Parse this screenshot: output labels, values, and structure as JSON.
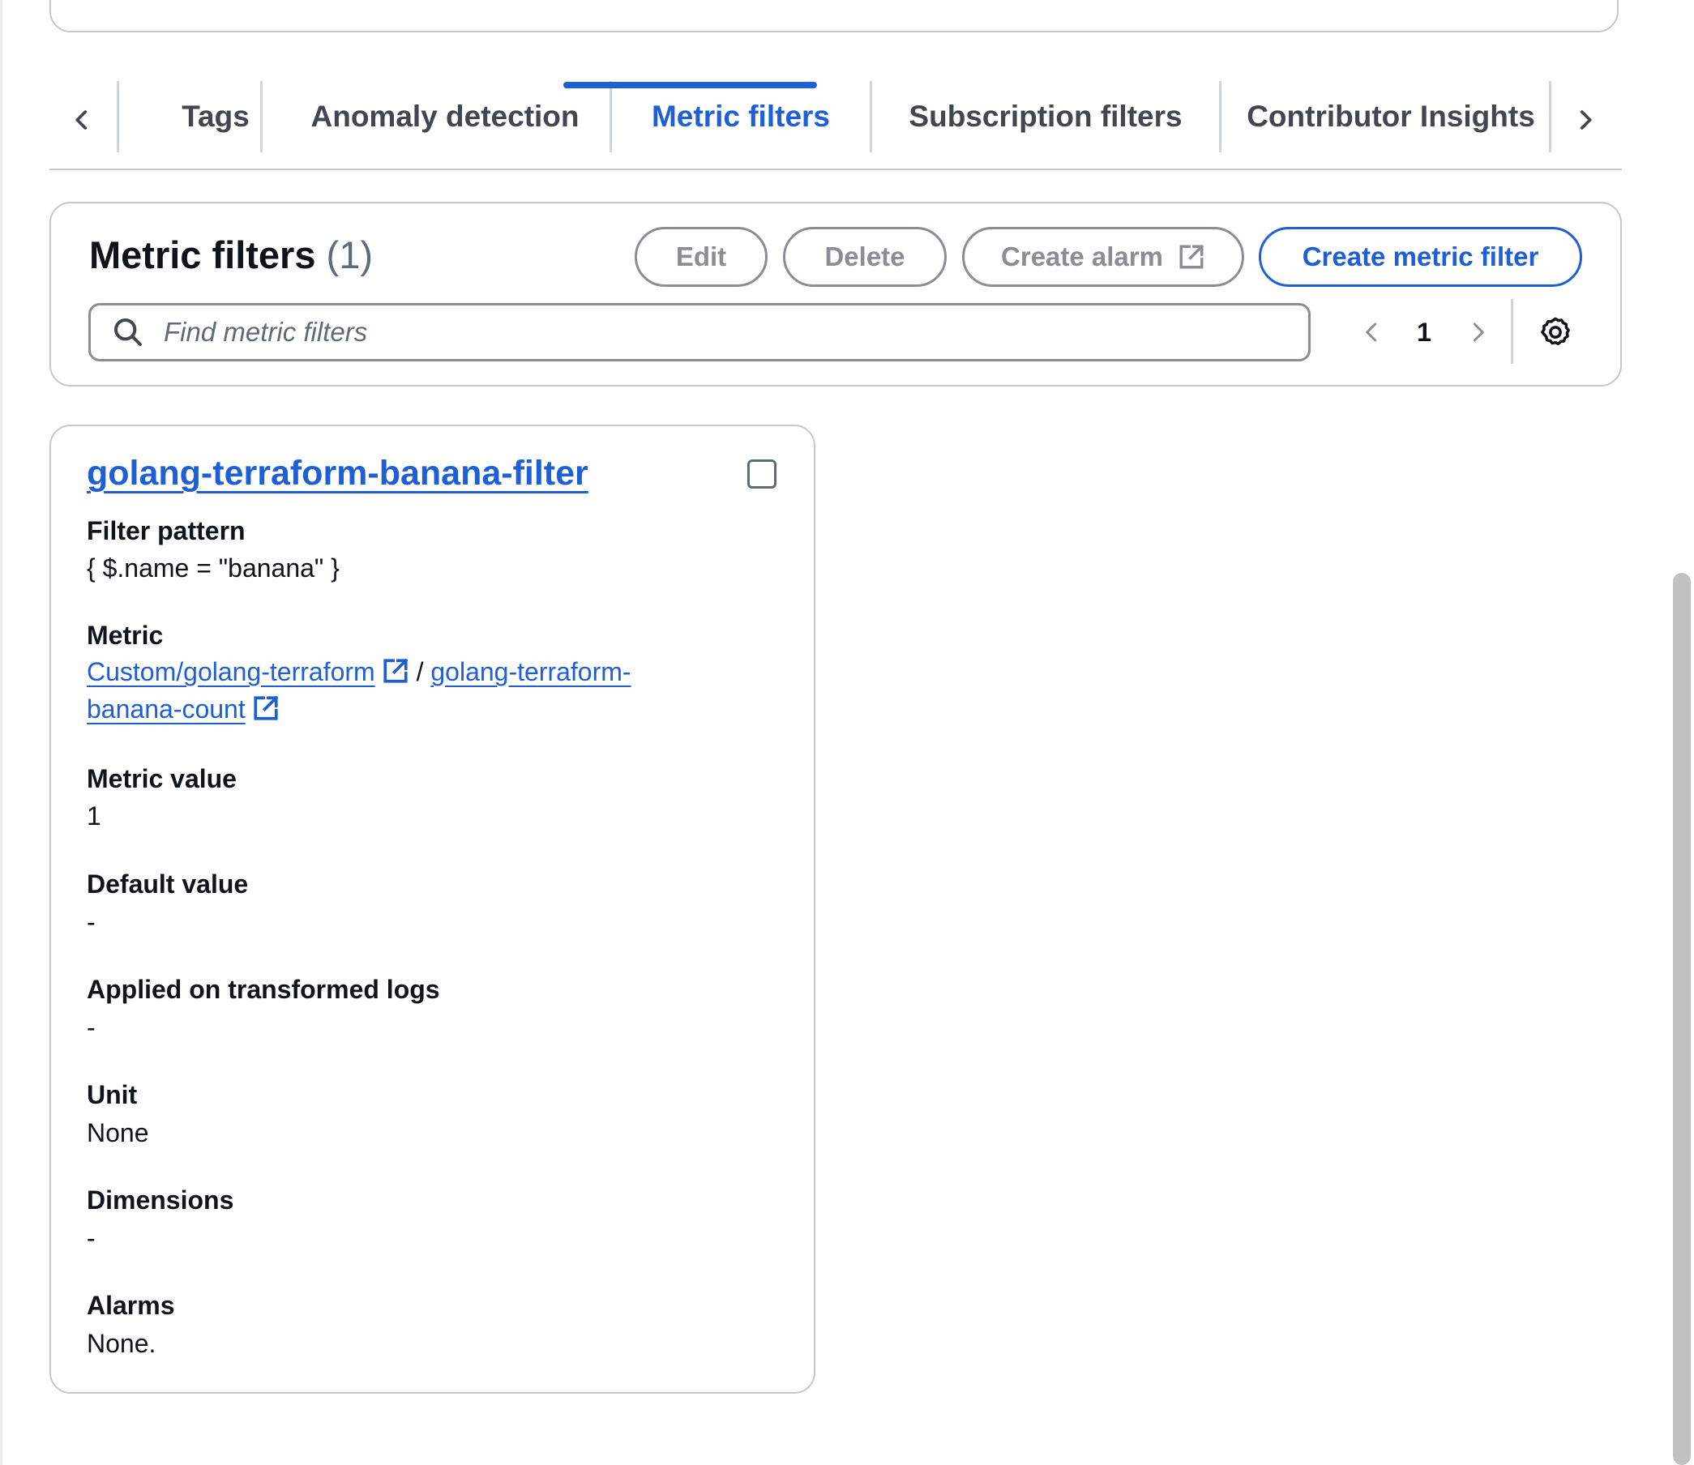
{
  "tabs": {
    "items": [
      {
        "label": "Tags"
      },
      {
        "label": "Anomaly detection"
      },
      {
        "label": "Metric filters"
      },
      {
        "label": "Subscription filters"
      },
      {
        "label": "Contributor Insights"
      }
    ],
    "active": "Metric filters"
  },
  "header": {
    "title": "Metric filters",
    "count": "(1)",
    "buttons": {
      "edit": "Edit",
      "delete": "Delete",
      "create_alarm": "Create alarm",
      "create_metric_filter": "Create metric filter"
    }
  },
  "search": {
    "placeholder": "Find metric filters",
    "value": ""
  },
  "pagination": {
    "current_page": "1"
  },
  "filter_card": {
    "name": "golang-terraform-banana-filter",
    "filter_pattern_label": "Filter pattern",
    "filter_pattern_value": "{ $.name = \"banana\" }",
    "metric_label": "Metric",
    "metric_namespace": "Custom/golang-terraform",
    "metric_separator": "/",
    "metric_name": "golang-terraform-banana-count",
    "metric_value_label": "Metric value",
    "metric_value": "1",
    "default_value_label": "Default value",
    "default_value": "-",
    "applied_label": "Applied on transformed logs",
    "applied_value": "-",
    "unit_label": "Unit",
    "unit_value": "None",
    "dimensions_label": "Dimensions",
    "dimensions_value": "-",
    "alarms_label": "Alarms",
    "alarms_value": "None."
  },
  "colors": {
    "link": "#1f5fd6",
    "text": "#0f141a",
    "muted": "#5f6b7a",
    "border": "#c6c6cd",
    "disabled": "#8c8c94"
  },
  "icons": {
    "tab_scroll_left": "chevron-left-icon",
    "tab_scroll_right": "chevron-right-icon",
    "search": "search-icon",
    "external_link": "external-link-icon",
    "settings": "gear-icon",
    "prev_page": "chevron-left-icon",
    "next_page": "chevron-right-icon"
  }
}
